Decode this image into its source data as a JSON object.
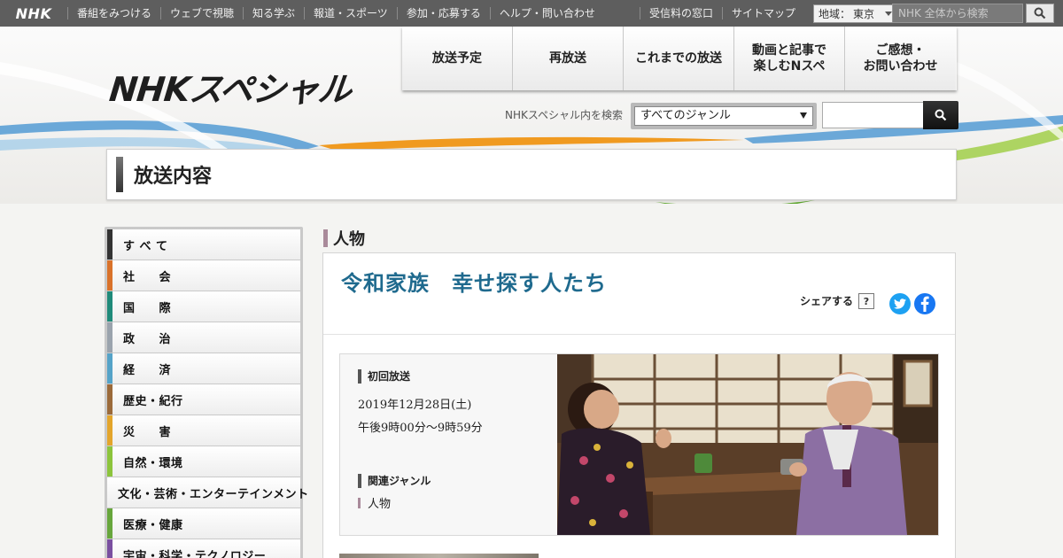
{
  "global": {
    "logo": "NHK",
    "nav": [
      "番組をみつける",
      "ウェブで視聴",
      "知る学ぶ",
      "報道・スポーツ",
      "参加・応募する",
      "ヘルプ・問い合わせ"
    ],
    "right_links": [
      "受信料の窓口",
      "サイトマップ"
    ],
    "region_label": "地域：",
    "region_value": "東京",
    "search_placeholder": "NHK 全体から検索"
  },
  "header": {
    "brand": "NHKスペシャル",
    "nav": [
      "放送予定",
      "再放送",
      "これまでの放送",
      "動画と記事で\n楽しむNスペ",
      "ご感想・\nお問い合わせ"
    ],
    "site_search_label": "NHKスペシャル内を検索",
    "genre_select_value": "すべてのジャンル"
  },
  "page_title": "放送内容",
  "sidebar": {
    "genres": [
      {
        "label": "す べ て",
        "color": "#333333"
      },
      {
        "label": "社　　会",
        "color": "#d9722a"
      },
      {
        "label": "国　　際",
        "color": "#1f8a7a"
      },
      {
        "label": "政　　治",
        "color": "#9aa3ad"
      },
      {
        "label": "経　　済",
        "color": "#55a3c8"
      },
      {
        "label": "歴史・紀行",
        "color": "#9b6a3a"
      },
      {
        "label": "災　　害",
        "color": "#e3a52b"
      },
      {
        "label": "自然・環境",
        "color": "#8cc43c"
      },
      {
        "label": "文化・芸術・エンターテインメント",
        "color": "#d8428a"
      },
      {
        "label": "医療・健康",
        "color": "#67a63c"
      },
      {
        "label": "宇宙・科学・テクノロジー",
        "color": "#7a4fa0"
      }
    ]
  },
  "content": {
    "genre_heading": "人物",
    "program_title": "令和家族　幸せ探す人たち",
    "share_label": "シェアする",
    "help_label": "?",
    "first_broadcast_label": "初回放送",
    "date": "2019年12月28日(土)",
    "time": "午後9時00分～9時59分",
    "related_genre_label": "関連ジャンル",
    "related_genre": "人物"
  },
  "colors": {
    "title_blue": "#1f6a8e",
    "global_bar": "#5e5e5e",
    "twitter": "#1da1f2",
    "facebook": "#1877f2"
  }
}
